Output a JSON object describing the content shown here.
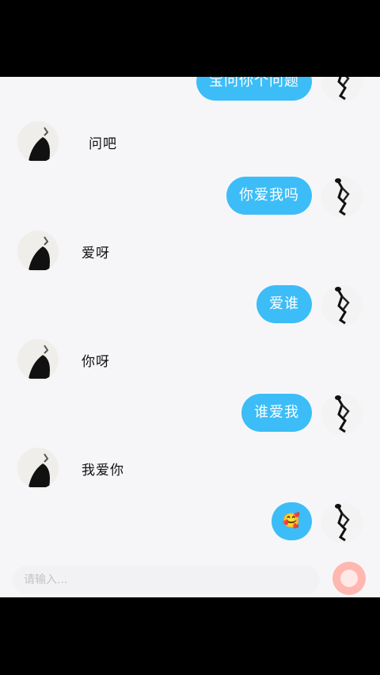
{
  "messages": [
    {
      "side": "right",
      "text": "宝问你个问题"
    },
    {
      "side": "left",
      "text": "问吧"
    },
    {
      "side": "right",
      "text": "你爱我吗"
    },
    {
      "side": "left",
      "text": "爱呀"
    },
    {
      "side": "right",
      "text": "爱谁"
    },
    {
      "side": "left",
      "text": "你呀"
    },
    {
      "side": "right",
      "text": "谁爱我"
    },
    {
      "side": "left",
      "text": "我爱你"
    },
    {
      "side": "right",
      "text": "🥰",
      "emoji": true
    }
  ],
  "input": {
    "placeholder": "请输入..."
  },
  "colors": {
    "bubble": "#3cbdf7",
    "send_button": "#ffb7b0"
  }
}
